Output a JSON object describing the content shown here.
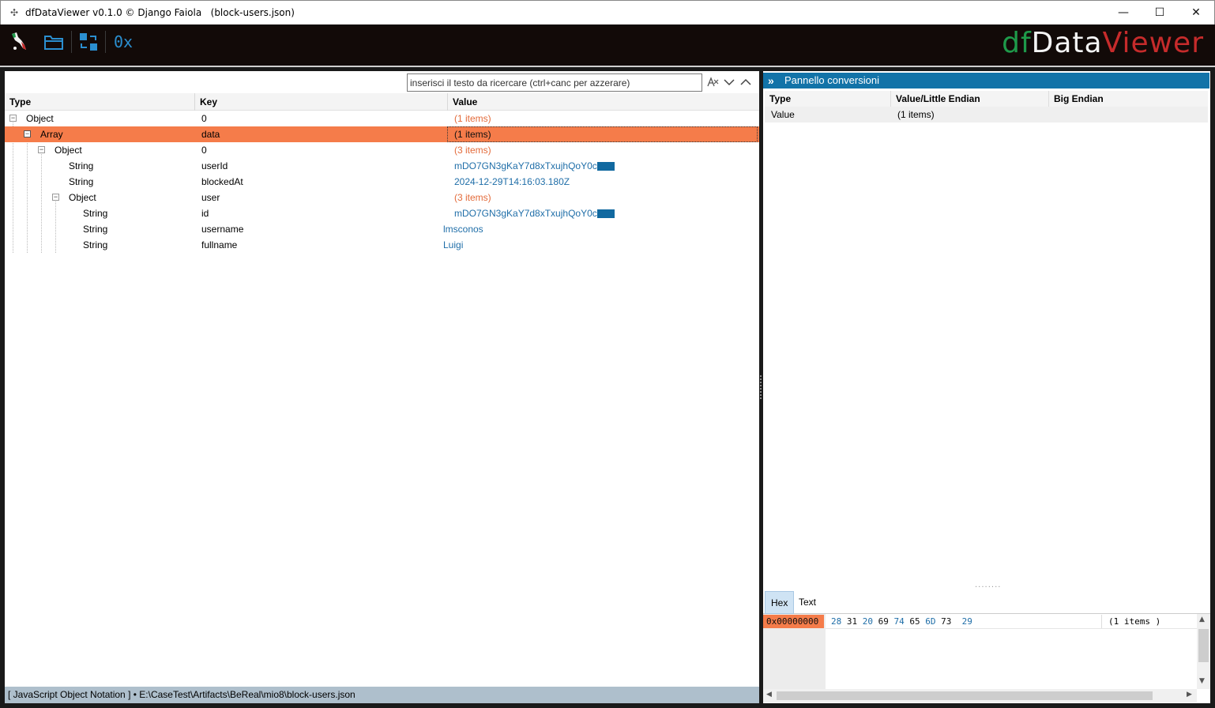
{
  "window": {
    "title": "dfDataViewer v0.1.0 © Django Faiola   (block-users.json)",
    "minimize": "—",
    "maximize": "☐",
    "close": "✕"
  },
  "toolbar": {
    "brand_df": "df",
    "brand_data": "Data",
    "brand_viewer": "Viewer",
    "hex_toggle_label": "0x"
  },
  "search": {
    "placeholder": "inserisci il testo da ricercare (ctrl+canc per azzerare)"
  },
  "tree": {
    "columns": [
      "Type",
      "Key",
      "Value"
    ],
    "rows": [
      {
        "type": "Object",
        "key": "0",
        "value": "(1 items)"
      },
      {
        "type": "Array",
        "key": "data",
        "value": "(1 items)"
      },
      {
        "type": "Object",
        "key": "0",
        "value": "(3 items)"
      },
      {
        "type": "String",
        "key": "userId",
        "value": "mDO7GN3gKaY7d8xTxujhQoY0c"
      },
      {
        "type": "String",
        "key": "blockedAt",
        "value": "2024-12-29T14:16:03.180Z"
      },
      {
        "type": "Object",
        "key": "user",
        "value": "(3 items)"
      },
      {
        "type": "String",
        "key": "id",
        "value": "mDO7GN3gKaY7d8xTxujhQoY0c"
      },
      {
        "type": "String",
        "key": "username",
        "value": "lmsconos"
      },
      {
        "type": "String",
        "key": "fullname",
        "value": "Luigi"
      }
    ]
  },
  "status": {
    "text": "[ JavaScript Object Notation ] • E:\\CaseTest\\Artifacts\\BeReal\\mio8\\block-users.json"
  },
  "conversions": {
    "title": "Pannello conversioni",
    "columns": [
      "Type",
      "Value/Little Endian",
      "Big Endian"
    ],
    "row": {
      "type": "Value",
      "value": "(1 items)",
      "big_endian": ""
    }
  },
  "hex": {
    "tabs": [
      "Hex",
      "Text"
    ],
    "address": "0x00000000",
    "bytes": [
      "28",
      "31",
      "20",
      "69",
      "74",
      "65",
      "6D",
      "73",
      "29"
    ],
    "text": "(1 items )"
  },
  "colors": {
    "selection": "#f57c4a",
    "accent_blue": "#1273a8",
    "status_bar": "#aebfcc"
  }
}
